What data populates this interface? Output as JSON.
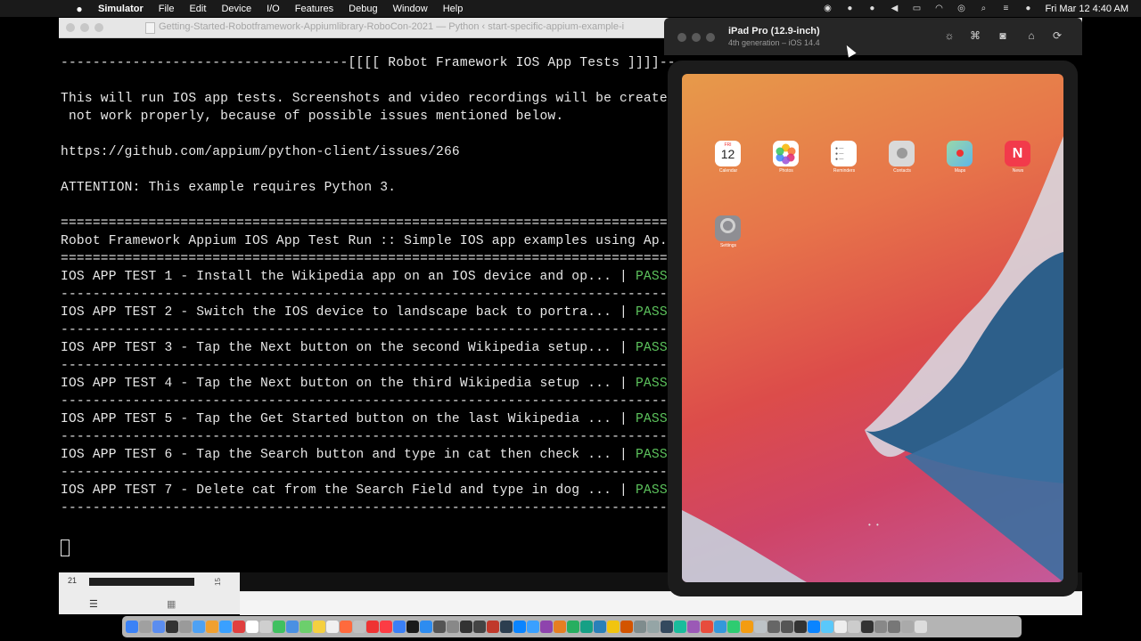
{
  "menubar": {
    "apple": "",
    "app_name": "Simulator",
    "items": [
      "File",
      "Edit",
      "Device",
      "I/O",
      "Features",
      "Debug",
      "Window",
      "Help"
    ],
    "clock": "Fri Mar 12  4:40 AM"
  },
  "terminal": {
    "title": "Getting-Started-Robotframework-Appiumlibrary-RoboCon-2021 — Python ‹ start-specific-appium-example-i",
    "lines": [
      "------------------------------------[[[[ Robot Framework IOS App Tests ]]]]---",
      "",
      "This will run IOS app tests. Screenshots and video recordings will be created",
      " not work properly, because of possible issues mentioned below.",
      "",
      "https://github.com/appium/python-client/issues/266",
      "",
      "ATTENTION: This example requires Python 3.",
      "",
      "==============================================================================",
      "Robot Framework Appium IOS App Test Run :: Simple IOS app examples using Ap...",
      "=============================================================================="
    ],
    "tests": [
      {
        "name": "IOS APP TEST 1 - Install the Wikipedia app on an IOS device and op... | ",
        "status": "PASS",
        "tail": " |"
      },
      {
        "name": "IOS APP TEST 2 - Switch the IOS device to landscape back to portra... | ",
        "status": "PASS",
        "tail": " |"
      },
      {
        "name": "IOS APP TEST 3 - Tap the Next button on the second Wikipedia setup... | ",
        "status": "PASS",
        "tail": " |"
      },
      {
        "name": "IOS APP TEST 4 - Tap the Next button on the third Wikipedia setup ... | ",
        "status": "PASS",
        "tail": " |"
      },
      {
        "name": "IOS APP TEST 5 - Tap the Get Started button on the last Wikipedia ... | ",
        "status": "PASS",
        "tail": " |"
      },
      {
        "name": "IOS APP TEST 6 - Tap the Search button and type in cat then check ... | ",
        "status": "PASS",
        "tail": " |"
      },
      {
        "name": "IOS APP TEST 7 - Delete cat from the Search Field and type in dog ... | ",
        "status": "PASS",
        "tail": " |"
      }
    ],
    "separator": "------------------------------------------------------------------------------",
    "bottom": {
      "line_number": "21",
      "line_number_2": "15"
    }
  },
  "simulator": {
    "device_name": "iPad Pro (12.9-inch)",
    "device_sub": "4th generation – iOS 14.4",
    "calendar_day": "FRI",
    "calendar_date": "12",
    "apps": [
      {
        "label": "Calendar",
        "color": "#ffffff"
      },
      {
        "label": "Photos",
        "color": "#ffffff"
      },
      {
        "label": "Reminders",
        "color": "#ffffff"
      },
      {
        "label": "Contacts",
        "color": "#d9d9d9"
      },
      {
        "label": "Maps",
        "color": "#8fd19e"
      },
      {
        "label": "News",
        "color": "#f23a4b"
      }
    ],
    "settings_label": "Settings",
    "page_dots": "• •"
  },
  "dock": {
    "colors": [
      "#3b82f6",
      "#a0a0a0",
      "#5b8def",
      "#333333",
      "#9a9a9a",
      "#4ea1f3",
      "#f0a030",
      "#3aa0ff",
      "#e04040",
      "#ffffff",
      "#cfcfcf",
      "#40c060",
      "#4a90e2",
      "#6ccf6c",
      "#f5d040",
      "#f0f0f0",
      "#ff6a3d",
      "#c0c0c0",
      "#e33",
      "#fc3c44",
      "#3a7ff6",
      "#1a1a1a",
      "#2d8cf0",
      "#555",
      "#888",
      "#333",
      "#444",
      "#c0392b",
      "#2c3e50",
      "#0a84ff",
      "#3aa0ff",
      "#8e44ad",
      "#e67e22",
      "#27ae60",
      "#16a085",
      "#2980b9",
      "#f1c40f",
      "#d35400",
      "#7f8c8d",
      "#95a5a6",
      "#34495e",
      "#1abc9c",
      "#9b59b6",
      "#e74c3c",
      "#3498db",
      "#2ecc71",
      "#f39c12",
      "#bdc3c7",
      "#666",
      "#555",
      "#333",
      "#0a84ff",
      "#5ac8fa",
      "#eee",
      "#ccc",
      "#333",
      "#888",
      "#777",
      "#aaa",
      "#ddd"
    ]
  }
}
